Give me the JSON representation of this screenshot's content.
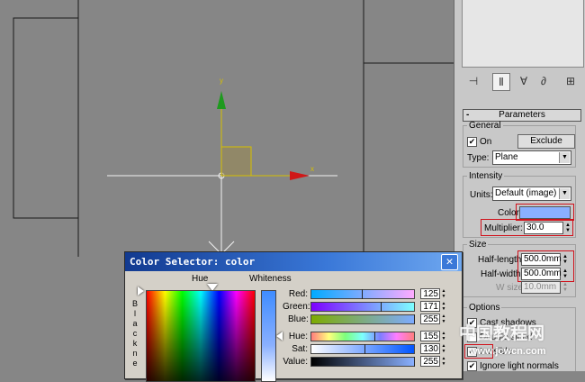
{
  "viewport": {
    "axis_y": "y",
    "axis_x": "x"
  },
  "panel": {
    "rollup_minus": "-",
    "rollup_title": "Parameters",
    "general": {
      "legend": "General",
      "on_label": "On",
      "on_checked": "✔",
      "exclude_label": "Exclude",
      "type_label": "Type:",
      "type_value": "Plane"
    },
    "intensity": {
      "legend": "Intensity",
      "units_label": "Units:",
      "units_value": "Default (image)",
      "color_label": "Color:",
      "color_value": "#8ab0ff",
      "multiplier_label": "Multiplier:",
      "multiplier_value": "30.0"
    },
    "size": {
      "legend": "Size",
      "half_length_label": "Half-length:",
      "half_length_value": "500.0mm",
      "half_width_label": "Half-width:",
      "half_width_value": "500.0mm",
      "w_size_label": "W size:",
      "w_size_value": "10.0mm"
    },
    "options": {
      "legend": "Options",
      "cast_shadows": "Cast shadows",
      "double_sided": "Double sided",
      "invisible": "Invisible",
      "ignore_normals": "Ignore light normals",
      "check": "✔"
    }
  },
  "dialog": {
    "title": "Color Selector: color",
    "close": "✕",
    "hue_label": "Hue",
    "whiteness_label": "Whiteness",
    "blackness_letters": [
      "B",
      "l",
      "a",
      "c",
      "k",
      "n",
      "e"
    ],
    "rows": [
      {
        "label": "Red:",
        "value": "125"
      },
      {
        "label": "Green:",
        "value": "171"
      },
      {
        "label": "Blue:",
        "value": "255"
      },
      {
        "label": "Hue:",
        "value": "155"
      },
      {
        "label": "Sat:",
        "value": "130"
      },
      {
        "label": "Value:",
        "value": "255"
      }
    ]
  },
  "watermark": {
    "main": "中国教程网",
    "sub": "www.jcwcn.com"
  },
  "icons": [
    "pin-icon",
    "modify-icon",
    "fork-icon",
    "make-unique-icon",
    "configure-icon"
  ]
}
